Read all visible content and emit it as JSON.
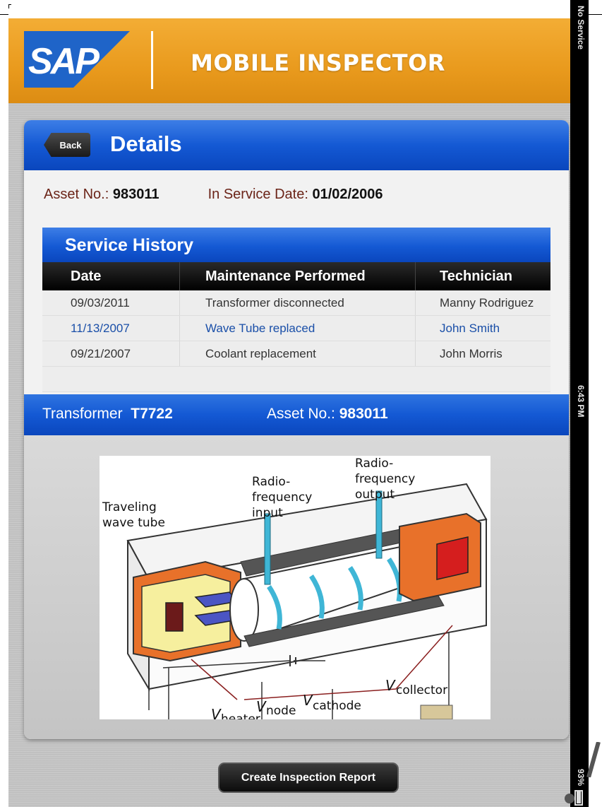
{
  "header": {
    "logo_text": "SAP",
    "app_title": "MOBILE INSPECTOR",
    "brand_color": "#e99a1d"
  },
  "details": {
    "back_label": "Back",
    "title": "Details",
    "asset_label": "Asset No.:",
    "asset_value": "983011",
    "in_service_label": "In Service Date:",
    "in_service_value": "01/02/2006"
  },
  "service_history": {
    "title": "Service History",
    "columns": [
      "Date",
      "Maintenance Performed",
      "Technician"
    ],
    "rows": [
      {
        "date": "09/03/2011",
        "maintenance": "Transformer disconnected",
        "technician": "Manny Rodriguez"
      },
      {
        "date": "11/13/2007",
        "maintenance": "Wave Tube replaced",
        "technician": "John Smith"
      },
      {
        "date": "09/21/2007",
        "maintenance": "Coolant replacement",
        "technician": "John Morris"
      }
    ]
  },
  "transformer_bar": {
    "transformer_label": "Transformer",
    "transformer_value": "T7722",
    "asset_label": "Asset No.:",
    "asset_value": "983011"
  },
  "diagram": {
    "label_traveling": "Traveling",
    "label_wave_tube": "wave tube",
    "label_rf_in_1": "Radio-",
    "label_rf_in_2": "frequency",
    "label_rf_in_3": "input",
    "label_rf_out_1": "Radio-",
    "label_rf_out_2": "frequency",
    "label_rf_out_3": "output",
    "v_collector_v": "V",
    "v_collector_sub": "collector",
    "v_cathode_v": "V",
    "v_cathode_sub": "cathode",
    "v_anode_v": "V",
    "v_anode_sub": "node",
    "v_heater_v": "V",
    "v_heater_sub": "heater"
  },
  "actions": {
    "create_report_label": "Create Inspection Report"
  },
  "status_bar": {
    "carrier": "No Service",
    "time": "6:43 PM",
    "battery": "93%"
  }
}
